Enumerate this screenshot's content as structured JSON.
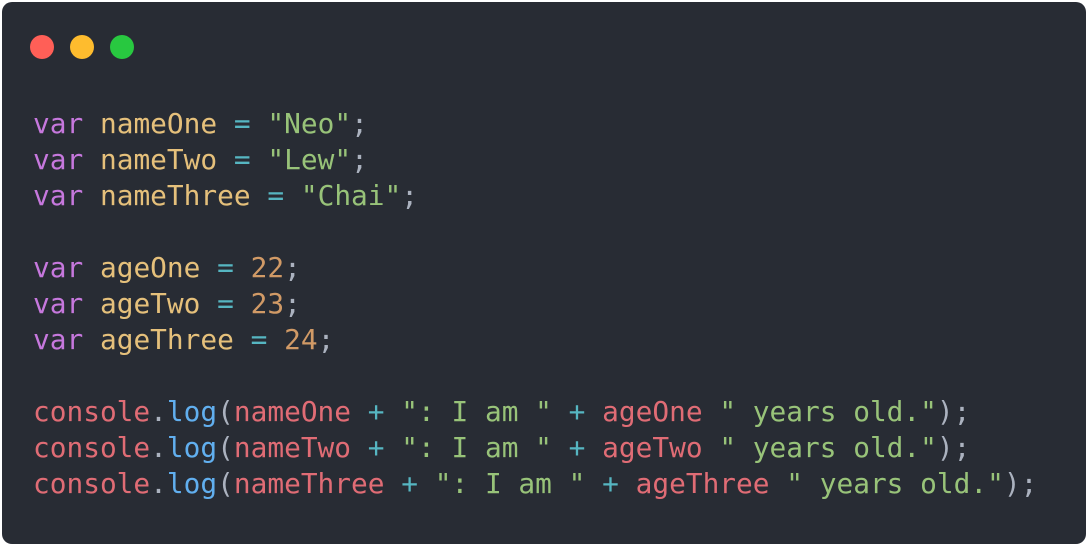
{
  "window": {
    "controls": [
      {
        "name": "close",
        "color": "#ff5f57"
      },
      {
        "name": "minimize",
        "color": "#febc2e"
      },
      {
        "name": "maximize",
        "color": "#28c840"
      }
    ]
  },
  "code": {
    "l1": {
      "kw": "var",
      "name": "nameOne",
      "op": "=",
      "str": "\"Neo\"",
      "end": ";"
    },
    "l2": {
      "kw": "var",
      "name": "nameTwo",
      "op": "=",
      "str": "\"Lew\"",
      "end": ";"
    },
    "l3": {
      "kw": "var",
      "name": "nameThree",
      "op": "=",
      "str": "\"Chai\"",
      "end": ";"
    },
    "l5": {
      "kw": "var",
      "name": "ageOne",
      "op": "=",
      "num": "22",
      "end": ";"
    },
    "l6": {
      "kw": "var",
      "name": "ageTwo",
      "op": "=",
      "num": "23",
      "end": ";"
    },
    "l7": {
      "kw": "var",
      "name": "ageThree",
      "op": "=",
      "num": "24",
      "end": ";"
    },
    "l9": {
      "obj": "console",
      "dot": ".",
      "fn": "log",
      "open": "(",
      "a1": "nameOne",
      "plus1": "+",
      "s1": "\": I am \"",
      "plus2": "+",
      "a2": "ageOne",
      "s2": "\" years old.\"",
      "close": ");"
    },
    "l10": {
      "obj": "console",
      "dot": ".",
      "fn": "log",
      "open": "(",
      "a1": "nameTwo",
      "plus1": "+",
      "s1": "\": I am \"",
      "plus2": "+",
      "a2": "ageTwo",
      "s2": "\" years old.\"",
      "close": ");"
    },
    "l11": {
      "obj": "console",
      "dot": ".",
      "fn": "log",
      "open": "(",
      "a1": "nameThree",
      "plus1": "+",
      "s1": "\": I am \"",
      "plus2": "+",
      "a2": "ageThree",
      "s2": "\" years old.\"",
      "close": ");"
    }
  }
}
